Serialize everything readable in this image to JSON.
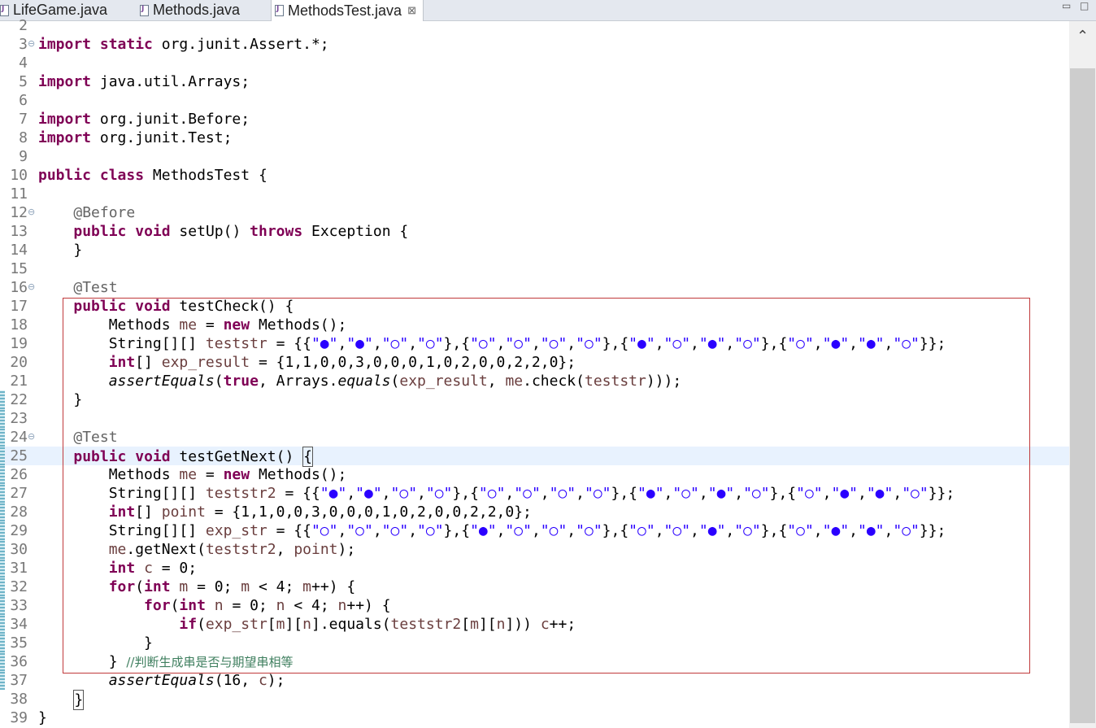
{
  "tabs": [
    {
      "label": "LifeGame.java",
      "active": false
    },
    {
      "label": "Methods.java",
      "active": false
    },
    {
      "label": "MethodsTest.java",
      "active": true,
      "close": "⊠"
    }
  ],
  "window_buttons": {
    "minimize": "▭",
    "maximize": "□"
  },
  "scrollbar": {
    "up_arrow": "⌃"
  },
  "editor": {
    "current_line": 25,
    "lines": [
      {
        "n": "2",
        "fold": "",
        "html": ""
      },
      {
        "n": "3",
        "fold": "⊖",
        "html": "<span class='kw'>import</span> <span class='kw'>static</span> org.junit.Assert.*;"
      },
      {
        "n": "4",
        "fold": "",
        "html": ""
      },
      {
        "n": "5",
        "fold": "",
        "html": "<span class='kw'>import</span> java.util.Arrays;"
      },
      {
        "n": "6",
        "fold": "",
        "html": ""
      },
      {
        "n": "7",
        "fold": "",
        "html": "<span class='kw'>import</span> org.junit.Before;"
      },
      {
        "n": "8",
        "fold": "",
        "html": "<span class='kw'>import</span> org.junit.Test;"
      },
      {
        "n": "9",
        "fold": "",
        "html": ""
      },
      {
        "n": "10",
        "fold": "",
        "html": "<span class='kw'>public</span> <span class='kw'>class</span> MethodsTest {"
      },
      {
        "n": "11",
        "fold": "",
        "html": ""
      },
      {
        "n": "12",
        "fold": "⊖",
        "html": "    <span class='ann'>@Before</span>"
      },
      {
        "n": "13",
        "fold": "",
        "html": "    <span class='kw'>public</span> <span class='kw'>void</span> setUp() <span class='kw'>throws</span> Exception {"
      },
      {
        "n": "14",
        "fold": "",
        "html": "    }"
      },
      {
        "n": "15",
        "fold": "",
        "html": ""
      },
      {
        "n": "16",
        "fold": "⊖",
        "html": "    <span class='ann'>@Test</span>"
      },
      {
        "n": "17",
        "fold": "",
        "html": "    <span class='kw'>public</span> <span class='kw'>void</span> testCheck() {"
      },
      {
        "n": "18",
        "fold": "",
        "html": "        Methods <span class='loc'>me</span> = <span class='kw'>new</span> Methods();"
      },
      {
        "n": "19",
        "fold": "",
        "html": "        String[][] <span class='loc'>teststr</span> = {{<span class='str'>\"●\"</span>,<span class='str'>\"●\"</span>,<span class='str'>\"○\"</span>,<span class='str'>\"○\"</span>},{<span class='str'>\"○\"</span>,<span class='str'>\"○\"</span>,<span class='str'>\"○\"</span>,<span class='str'>\"○\"</span>},{<span class='str'>\"●\"</span>,<span class='str'>\"○\"</span>,<span class='str'>\"●\"</span>,<span class='str'>\"○\"</span>},{<span class='str'>\"○\"</span>,<span class='str'>\"●\"</span>,<span class='str'>\"●\"</span>,<span class='str'>\"○\"</span>}};"
      },
      {
        "n": "20",
        "fold": "",
        "html": "        <span class='kw'>int</span>[] <span class='loc'>exp_result</span> = {1,1,0,0,3,0,0,0,1,0,2,0,0,2,2,0};"
      },
      {
        "n": "21",
        "fold": "",
        "html": "        <span class='ital'>assertEquals</span>(<span class='kw'>true</span>, Arrays.<span class='ital'>equals</span>(<span class='loc'>exp_result</span>, <span class='loc'>me</span>.check(<span class='loc'>teststr</span>)));"
      },
      {
        "n": "22",
        "fold": "",
        "html": "    }"
      },
      {
        "n": "23",
        "fold": "",
        "html": ""
      },
      {
        "n": "24",
        "fold": "⊖",
        "html": "    <span class='ann'>@Test</span>"
      },
      {
        "n": "25",
        "fold": "",
        "html": "    <span class='kw'>public</span> <span class='kw'>void</span> testGetNext() <span class='caretbox'>{</span>"
      },
      {
        "n": "26",
        "fold": "",
        "html": "        Methods <span class='loc'>me</span> = <span class='kw'>new</span> Methods();"
      },
      {
        "n": "27",
        "fold": "",
        "html": "        String[][] <span class='loc'>teststr2</span> = {{<span class='str'>\"●\"</span>,<span class='str'>\"●\"</span>,<span class='str'>\"○\"</span>,<span class='str'>\"○\"</span>},{<span class='str'>\"○\"</span>,<span class='str'>\"○\"</span>,<span class='str'>\"○\"</span>,<span class='str'>\"○\"</span>},{<span class='str'>\"●\"</span>,<span class='str'>\"○\"</span>,<span class='str'>\"●\"</span>,<span class='str'>\"○\"</span>},{<span class='str'>\"○\"</span>,<span class='str'>\"●\"</span>,<span class='str'>\"●\"</span>,<span class='str'>\"○\"</span>}};"
      },
      {
        "n": "28",
        "fold": "",
        "html": "        <span class='kw'>int</span>[] <span class='loc'>point</span> = {1,1,0,0,3,0,0,0,1,0,2,0,0,2,2,0};"
      },
      {
        "n": "29",
        "fold": "",
        "html": "        String[][] <span class='loc'>exp_str</span> = {{<span class='str'>\"○\"</span>,<span class='str'>\"○\"</span>,<span class='str'>\"○\"</span>,<span class='str'>\"○\"</span>},{<span class='str'>\"●\"</span>,<span class='str'>\"○\"</span>,<span class='str'>\"○\"</span>,<span class='str'>\"○\"</span>},{<span class='str'>\"○\"</span>,<span class='str'>\"○\"</span>,<span class='str'>\"●\"</span>,<span class='str'>\"○\"</span>},{<span class='str'>\"○\"</span>,<span class='str'>\"●\"</span>,<span class='str'>\"●\"</span>,<span class='str'>\"○\"</span>}};"
      },
      {
        "n": "30",
        "fold": "",
        "html": "        <span class='loc'>me</span>.getNext(<span class='loc'>teststr2</span>, <span class='loc'>point</span>);"
      },
      {
        "n": "31",
        "fold": "",
        "html": "        <span class='kw'>int</span> <span class='loc'>c</span> = 0;"
      },
      {
        "n": "32",
        "fold": "",
        "html": "        <span class='kw'>for</span>(<span class='kw'>int</span> <span class='loc'>m</span> = 0; <span class='loc'>m</span> &lt; 4; <span class='loc'>m</span>++) {"
      },
      {
        "n": "33",
        "fold": "",
        "html": "            <span class='kw'>for</span>(<span class='kw'>int</span> <span class='loc'>n</span> = 0; <span class='loc'>n</span> &lt; 4; <span class='loc'>n</span>++) {"
      },
      {
        "n": "34",
        "fold": "",
        "html": "                <span class='kw'>if</span>(<span class='loc'>exp_str</span>[<span class='loc'>m</span>][<span class='loc'>n</span>].equals(<span class='loc'>teststr2</span>[<span class='loc'>m</span>][<span class='loc'>n</span>])) <span class='loc'>c</span>++;"
      },
      {
        "n": "35",
        "fold": "",
        "html": "            }"
      },
      {
        "n": "36",
        "fold": "",
        "html": "        } <span class='cmt'>//判断生成串是否与期望串相等</span>"
      },
      {
        "n": "37",
        "fold": "",
        "html": "        <span class='ital'>assertEquals</span>(16, <span class='loc'>c</span>);"
      },
      {
        "n": "38",
        "fold": "",
        "html": "    <span class='caretbox'>}</span>"
      },
      {
        "n": "39",
        "fold": "",
        "html": "}"
      }
    ]
  }
}
